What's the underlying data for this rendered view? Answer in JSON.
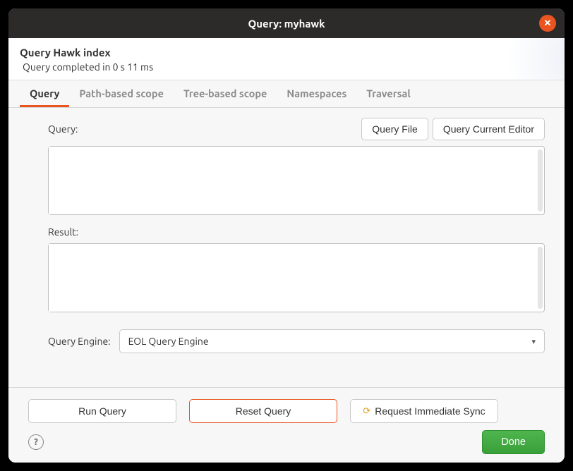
{
  "titlebar": {
    "title": "Query: myhawk"
  },
  "header": {
    "title": "Query Hawk index",
    "status": "Query completed in 0 s 11 ms"
  },
  "tabs": [
    {
      "label": "Query",
      "active": true
    },
    {
      "label": "Path-based scope",
      "active": false
    },
    {
      "label": "Tree-based scope",
      "active": false
    },
    {
      "label": "Namespaces",
      "active": false
    },
    {
      "label": "Traversal",
      "active": false
    }
  ],
  "queryPane": {
    "queryLabel": "Query:",
    "queryFileBtn": "Query File",
    "queryCurrentEditorBtn": "Query Current Editor",
    "queryText": "",
    "resultLabel": "Result:",
    "resultText": "",
    "engineLabel": "Query Engine:",
    "engineSelected": "EOL Query Engine"
  },
  "footer": {
    "runQuery": "Run Query",
    "resetQuery": "Reset Query",
    "requestSync": "Request Immediate Sync",
    "done": "Done"
  },
  "icons": {
    "close": "✕",
    "help": "?",
    "caret": "▾",
    "sync": "⟳"
  }
}
